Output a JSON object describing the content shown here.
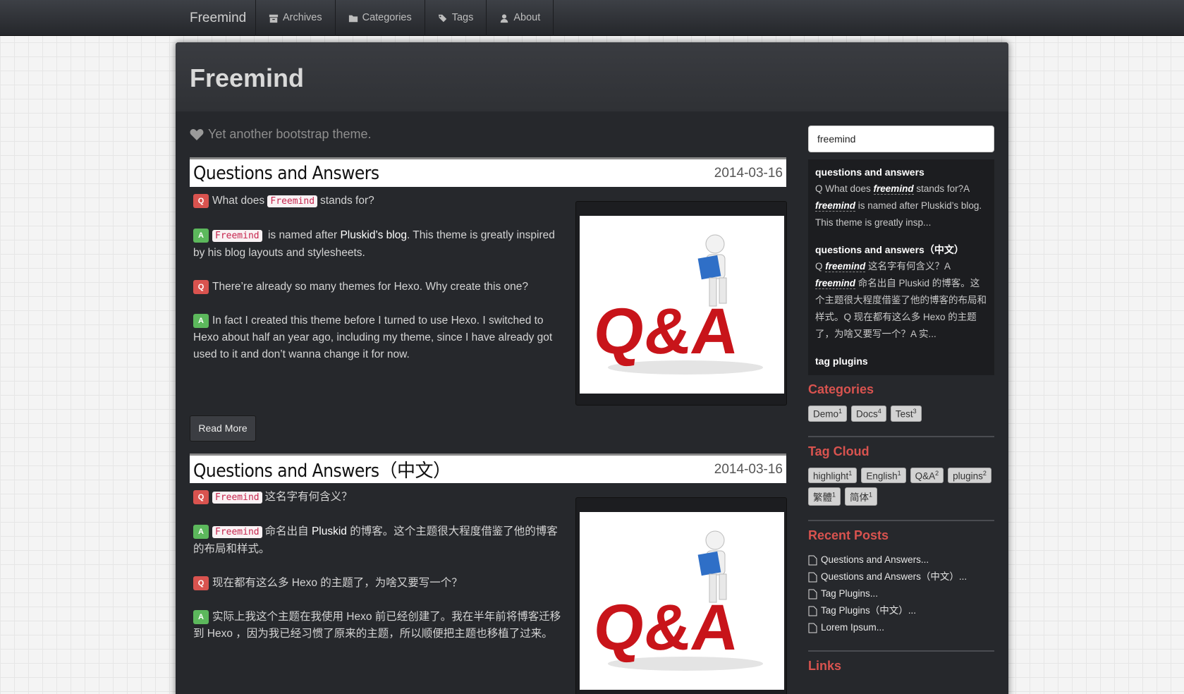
{
  "nav": {
    "brand": "Freemind",
    "items": [
      {
        "label": "Archives",
        "icon": "archive-icon"
      },
      {
        "label": "Categories",
        "icon": "folder-icon"
      },
      {
        "label": "Tags",
        "icon": "tags-icon"
      },
      {
        "label": "About",
        "icon": "user-icon"
      }
    ]
  },
  "header": {
    "title": "Freemind",
    "tagline": "Yet another bootstrap theme."
  },
  "articles": [
    {
      "title": "Questions and Answers",
      "date": "2014-03-16",
      "paras": [
        {
          "type": "Q",
          "code": "Freemind",
          "text": "What does",
          "text_after": "stands for?"
        },
        {
          "type": "A",
          "code": "Freemind",
          "text_after": "is named after",
          "link": "Pluskid’s blog",
          "text_end": ". This theme is greatly inspired by his blog layouts and stylesheets."
        },
        {
          "type": "Q",
          "text": "There’re already so many themes for Hexo. Why create this one?"
        },
        {
          "type": "A",
          "text": "In fact I created this theme before I turned to use Hexo. I switched to Hexo about half an year ago, including my theme, since I have already got used to it and don’t wanna change it for now."
        }
      ],
      "read_more": "Read More"
    },
    {
      "title": "Questions and Answers（中文）",
      "date": "2014-03-16",
      "paras": [
        {
          "type": "Q",
          "code": "Freemind",
          "text_after": "这名字有何含义？"
        },
        {
          "type": "A",
          "code": "Freemind",
          "text_after": "命名出自",
          "link": "Pluskid",
          "text_end": " 的博客。这个主题很大程度借鉴了他的博客的布局和样式。"
        },
        {
          "type": "Q",
          "text": "现在都有这么多 Hexo 的主题了，为啥又要写一个？"
        },
        {
          "type": "A",
          "text": "实际上我这个主题在我使用 Hexo 前已经创建了。我在半年前将博客迁移到 Hexo ，因为我已经习惯了原来的主题，所以顺便把主题也移植了过来。"
        }
      ]
    }
  ],
  "image": {
    "label": "Q&A"
  },
  "sidebar": {
    "search_value": "freemind",
    "results": [
      {
        "title": "questions and answers",
        "pre": "Q What does ",
        "kw1": "freemind",
        "mid": " stands for?A ",
        "kw2": "freemind",
        "post": " is named after Pluskid’s blog. This theme is greatly insp..."
      },
      {
        "title": "questions and answers（中文）",
        "pre": "Q ",
        "kw1": "freemind",
        "mid": " 这名字有何含义？A ",
        "kw2": "freemind",
        "post": " 命名出自 Pluskid 的博客。这个主题很大程度借鉴了他的博客的布局和样式。Q 现在都有这么多 Hexo 的主题了，为啥又要写一个？A 实..."
      },
      {
        "title": "tag plugins"
      }
    ],
    "categories_heading": "Categories",
    "categories": [
      {
        "name": "Demo",
        "count": "1"
      },
      {
        "name": "Docs",
        "count": "4"
      },
      {
        "name": "Test",
        "count": "3"
      }
    ],
    "tagcloud_heading": "Tag Cloud",
    "tags": [
      {
        "name": "highlight",
        "count": "1"
      },
      {
        "name": "English",
        "count": "1"
      },
      {
        "name": "Q&A",
        "count": "2"
      },
      {
        "name": "plugins",
        "count": "2"
      },
      {
        "name": "繁體",
        "count": "1"
      },
      {
        "name": "简体",
        "count": "1"
      }
    ],
    "recent_heading": "Recent Posts",
    "recent": [
      "Questions and Answers...",
      "Questions and Answers（中文）...",
      "Tag Plugins...",
      "Tag Plugins（中文）...",
      "Lorem Ipsum..."
    ],
    "links_heading": "Links"
  }
}
